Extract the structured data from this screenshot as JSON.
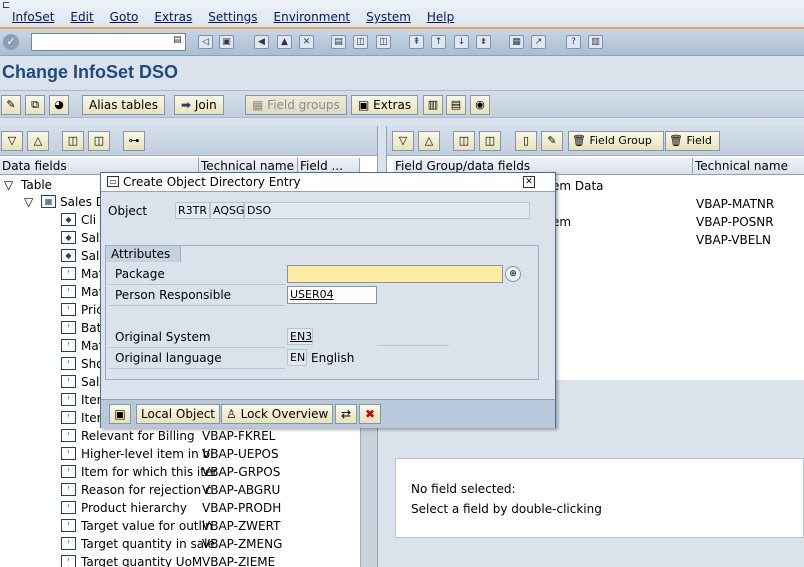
{
  "menu": [
    "InfoSet",
    "Edit",
    "Goto",
    "Extras",
    "Settings",
    "Environment",
    "System",
    "Help"
  ],
  "command_field": {
    "value": ""
  },
  "page_title": "Change InfoSet DSO",
  "app_toolbar": {
    "alias_tables": "Alias tables",
    "join": "Join",
    "field_groups": "Field groups",
    "extras": "Extras"
  },
  "left_pane": {
    "col_data_fields": "Data fields",
    "col_technical_name": "Technical name",
    "col_field": "Field ...",
    "table_label": "Table",
    "sales_node": "Sales D",
    "partial_rows": [
      "Cli",
      "Sal",
      "Sal",
      "Mat",
      "Mat",
      "Pric",
      "Bat",
      "Mat",
      "Sho",
      "Sal",
      "Iter",
      "Iter"
    ],
    "rows": [
      {
        "text": "Relevant for Billing",
        "tech": "VBAP-FKREL"
      },
      {
        "text": "Higher-level item in bi",
        "tech": "VBAP-UEPOS"
      },
      {
        "text": "Item for which this iter",
        "tech": "VBAP-GRPOS"
      },
      {
        "text": "Reason for rejection c",
        "tech": "VBAP-ABGRU"
      },
      {
        "text": "Product hierarchy",
        "tech": "VBAP-PRODH"
      },
      {
        "text": "Target value for outlin",
        "tech": "VBAP-ZWERT"
      },
      {
        "text": "Target quantity in sale",
        "tech": "VBAP-ZMENG"
      },
      {
        "text": "Target quantity UoM",
        "tech": "VBAP-ZIEME"
      }
    ]
  },
  "right_pane": {
    "btn_field_group": "Field Group",
    "btn_field": "Field",
    "col_field_group": "Field Group/data fields",
    "col_technical_name": "Technical name",
    "partial_item_data": "em Data",
    "partial_item": "em",
    "tech_values": [
      "VBAP-MATNR",
      "VBAP-POSNR",
      "VBAP-VBELN"
    ],
    "info_line1": "No field selected:",
    "info_line2": "Select a field by double-clicking"
  },
  "dialog": {
    "title": "Create Object Directory Entry",
    "object_label": "Object",
    "object_values": [
      "R3TR",
      "AQSG",
      "DSO"
    ],
    "attributes_tab": "Attributes",
    "package_label": "Package",
    "package_value": "",
    "person_label": "Person Responsible",
    "person_value": "USER04",
    "orig_system_label": "Original System",
    "orig_system_value": "EN3",
    "orig_lang_label": "Original language",
    "orig_lang_code": "EN",
    "orig_lang_name": "English",
    "btn_local_object": "Local Object",
    "btn_lock_overview": "Lock Overview"
  }
}
